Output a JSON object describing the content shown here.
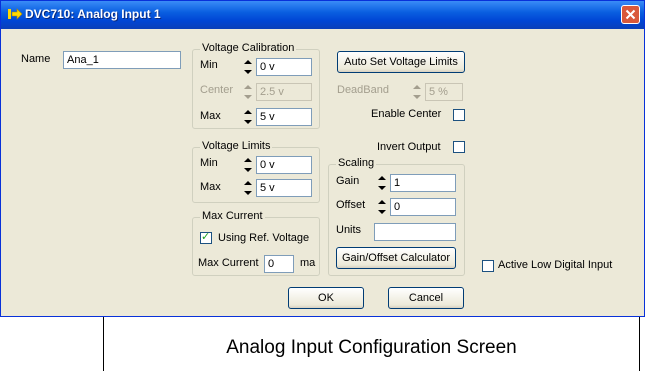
{
  "window": {
    "title": "DVC710: Analog Input 1"
  },
  "name_field": {
    "label": "Name",
    "value": "Ana_1"
  },
  "voltage_calibration": {
    "title": "Voltage Calibration",
    "min_label": "Min",
    "min_value": "0 v",
    "center_label": "Center",
    "center_value": "2.5 v",
    "max_label": "Max",
    "max_value": "5 v"
  },
  "auto_set_button": "Auto Set Voltage Limits",
  "deadband": {
    "label": "DeadBand",
    "value": "5 %"
  },
  "enable_center": {
    "label": "Enable Center",
    "checked": false
  },
  "invert_output": {
    "label": "Invert Output",
    "checked": false
  },
  "voltage_limits": {
    "title": "Voltage Limits",
    "min_label": "Min",
    "min_value": "0 v",
    "max_label": "Max",
    "max_value": "5 v"
  },
  "scaling": {
    "title": "Scaling",
    "gain_label": "Gain",
    "gain_value": "1",
    "offset_label": "Offset",
    "offset_value": "0",
    "units_label": "Units",
    "units_value": "",
    "calculator_button": "Gain/Offset Calculator"
  },
  "max_current": {
    "title": "Max Current",
    "using_ref_label": "Using Ref. Voltage",
    "using_ref_checked": true,
    "max_current_label": "Max Current",
    "max_current_value": "0",
    "unit": "ma"
  },
  "active_low": {
    "label": "Active Low Digital Input",
    "checked": false
  },
  "buttons": {
    "ok": "OK",
    "cancel": "Cancel"
  },
  "caption": "Analog Input Configuration Screen"
}
